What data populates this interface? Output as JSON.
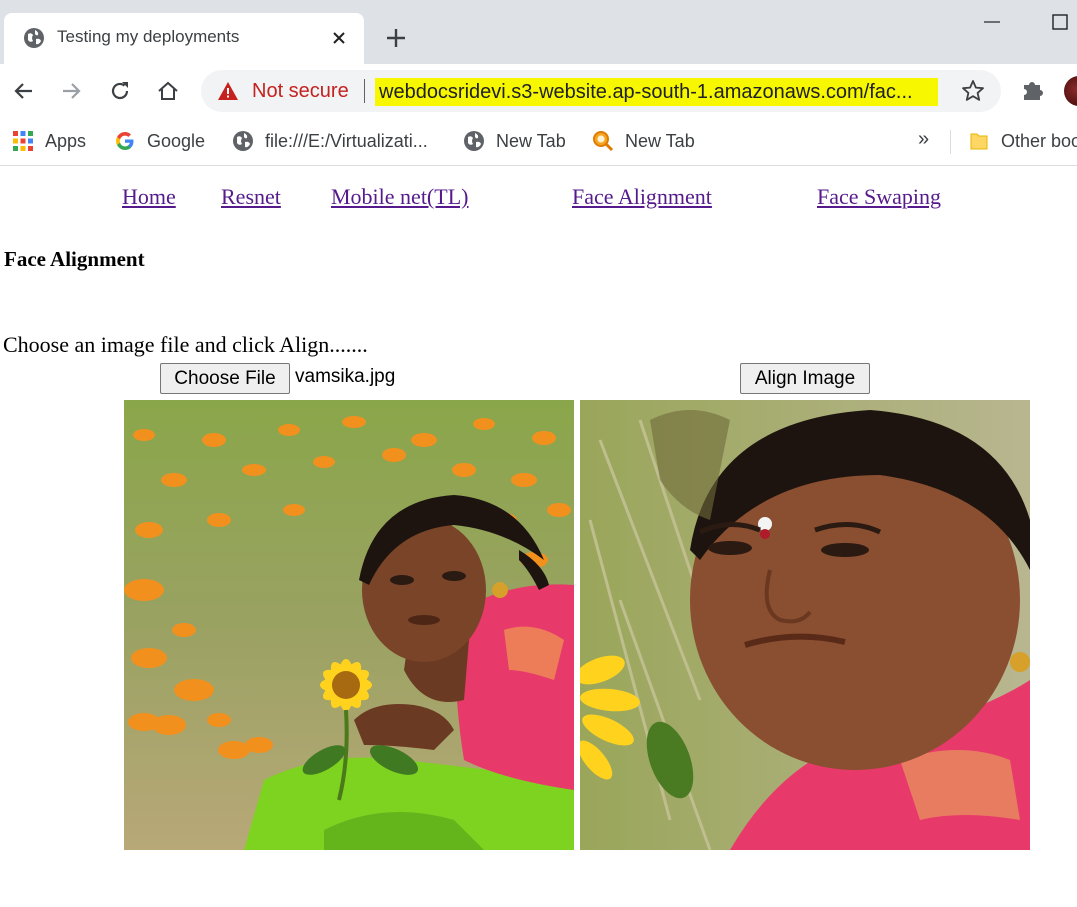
{
  "browser": {
    "tab": {
      "title": "Testing my deployments",
      "favicon": "globe-icon"
    },
    "omnibox": {
      "security_label": "Not secure",
      "url": "webdocsridevi.s3-website.ap-south-1.amazonaws.com/fac..."
    },
    "bookmarks": [
      {
        "label": "Apps",
        "icon": "apps-grid-icon"
      },
      {
        "label": "Google",
        "icon": "google-icon"
      },
      {
        "label": "file:///E:/Virtualizati...",
        "icon": "globe-icon"
      },
      {
        "label": "New Tab",
        "icon": "globe-icon"
      },
      {
        "label": "New Tab",
        "icon": "magnifier-icon"
      }
    ],
    "more_bookmarks": "»",
    "other_bookmarks": "Other boo"
  },
  "page": {
    "nav": [
      "Home",
      "Resnet",
      "Mobile net(TL)",
      "Face Alignment",
      "Face Swaping"
    ],
    "heading": "Face Alignment",
    "instructions": "Choose an image file and click Align.......",
    "file_input": {
      "button_label": "Choose File",
      "file_name": "vamsika.jpg"
    },
    "align_button": "Align Image"
  },
  "colors": {
    "link": "#551a8b",
    "url_highlight": "#f7f700",
    "insecure_red": "#c5221f"
  }
}
